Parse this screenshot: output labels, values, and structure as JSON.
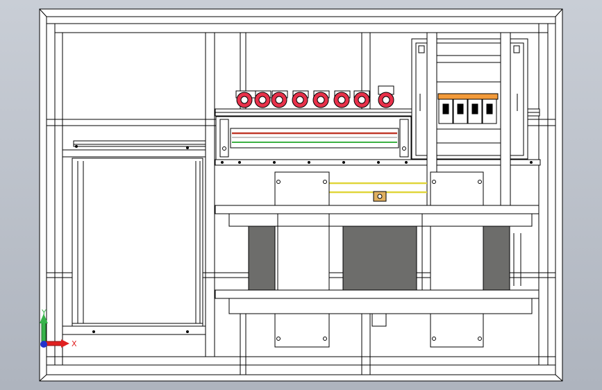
{
  "viewport": {
    "background_top": "#c9ced6",
    "background_bottom": "#aeb4be",
    "line_color": "#000000",
    "panel_fill": "#ffffff"
  },
  "components": {
    "current_transformer_count": 8,
    "current_transformer_color": "#e8314a",
    "breaker_count": 4,
    "breaker_strip_color": "#f29a3a",
    "transformer_core_color": "#6d6d6b",
    "busbar_yellow": "#e0d63a",
    "wire_red": "#c0392b",
    "wire_green": "#3cb043"
  },
  "triad": {
    "x_label": "X",
    "y_label": "Y",
    "x_color": "#e02020",
    "y_color": "#37b34a",
    "z_color": "#2233cc"
  }
}
